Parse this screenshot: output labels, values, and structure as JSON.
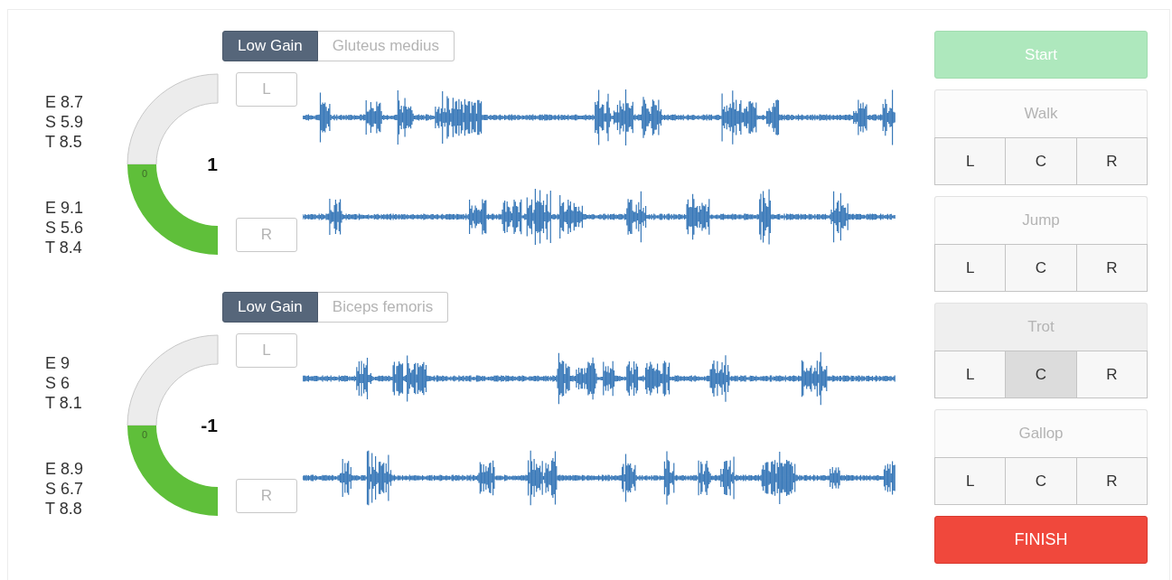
{
  "muscles": [
    {
      "tabs": [
        {
          "label": "Low Gain",
          "selected": true
        },
        {
          "label": "Gluteus medius",
          "selected": false
        }
      ],
      "stats_top": [
        "E 8.7",
        "S 5.9",
        "T 8.5"
      ],
      "stats_bottom": [
        "E 9.1",
        "S 5.6",
        "T 8.4"
      ],
      "gauge": {
        "zero_label": "0",
        "reading": "1"
      },
      "channels": [
        "L",
        "R"
      ]
    },
    {
      "tabs": [
        {
          "label": "Low Gain",
          "selected": true
        },
        {
          "label": "Biceps femoris",
          "selected": false
        }
      ],
      "stats_top": [
        "E 9",
        "S 6",
        "T 8.1"
      ],
      "stats_bottom": [
        "E 8.9",
        "S 6.7",
        "T 8.8"
      ],
      "gauge": {
        "zero_label": "0",
        "reading": "-1"
      },
      "channels": [
        "L",
        "R"
      ]
    }
  ],
  "start_button": "Start",
  "gaits": [
    {
      "label": "Walk",
      "active": false,
      "sides": [
        {
          "label": "L",
          "selected": false
        },
        {
          "label": "C",
          "selected": false
        },
        {
          "label": "R",
          "selected": false
        }
      ]
    },
    {
      "label": "Jump",
      "active": false,
      "sides": [
        {
          "label": "L",
          "selected": false
        },
        {
          "label": "C",
          "selected": false
        },
        {
          "label": "R",
          "selected": false
        }
      ]
    },
    {
      "label": "Trot",
      "active": true,
      "sides": [
        {
          "label": "L",
          "selected": false
        },
        {
          "label": "C",
          "selected": true
        },
        {
          "label": "R",
          "selected": false
        }
      ]
    },
    {
      "label": "Gallop",
      "active": false,
      "sides": [
        {
          "label": "L",
          "selected": false
        },
        {
          "label": "C",
          "selected": false
        },
        {
          "label": "R",
          "selected": false
        }
      ]
    }
  ],
  "finish_button": "FINISH"
}
